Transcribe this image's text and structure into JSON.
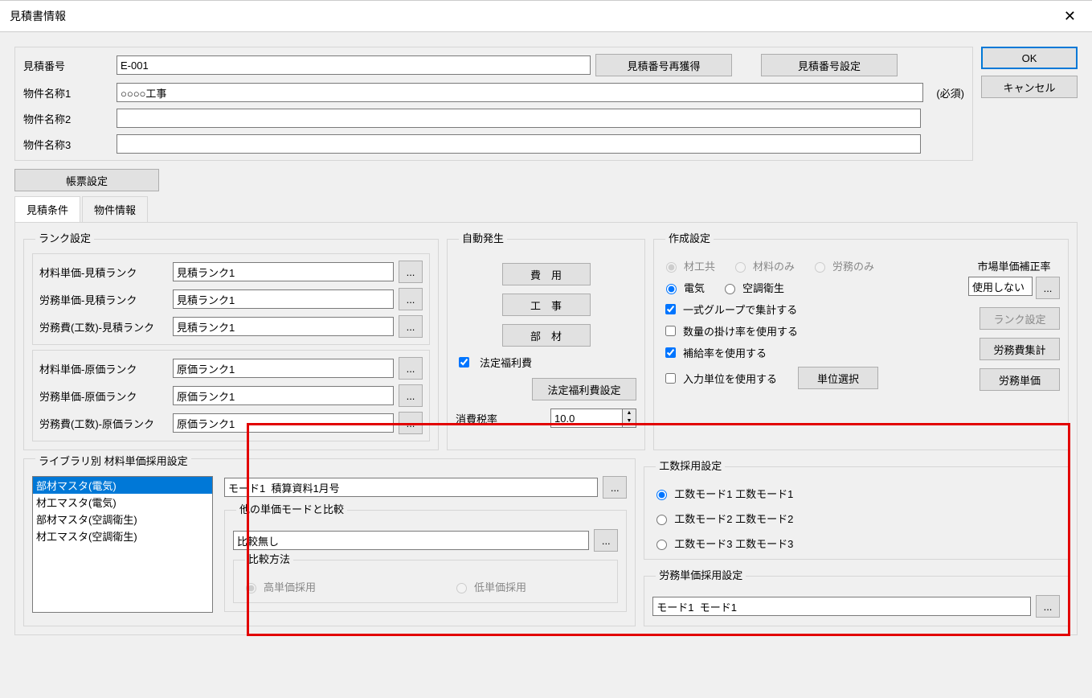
{
  "window": {
    "title": "見積書情報"
  },
  "buttons": {
    "ok": "OK",
    "cancel": "キャンセル",
    "reacquire": "見積番号再獲得",
    "numset": "見積番号設定",
    "form": "帳票設定",
    "cost": "費　用",
    "work": "工　事",
    "parts": "部　材",
    "welfare": "法定福利費設定",
    "rankset": "ランク設定",
    "laboragg": "労務費集計",
    "laborunit": "労務単価",
    "unitsel": "単位選択",
    "ellipsis": "..."
  },
  "labels": {
    "estno": "見積番号",
    "name1": "物件名称1",
    "name2": "物件名称2",
    "name3": "物件名称3",
    "required": "(必須)",
    "tab1": "見積条件",
    "tab2": "物件情報",
    "rank_legend": "ランク設定",
    "auto_legend": "自動発生",
    "create_legend": "作成設定",
    "r1": "材料単価-見積ランク",
    "r2": "労務単価-見積ランク",
    "r3": "労務費(工数)-見積ランク",
    "r4": "材料単価-原価ランク",
    "r5": "労務単価-原価ランク",
    "r6": "労務費(工数)-原価ランク",
    "welfare_chk": "法定福利費",
    "tax": "消費税率",
    "opt_both": "材工共",
    "opt_mat": "材料のみ",
    "opt_lab": "労務のみ",
    "opt_elec": "電気",
    "opt_hvac": "空調衛生",
    "chk_group": "一式グループで集計する",
    "chk_mult": "数量の掛け率を使用する",
    "chk_supp": "補給率を使用する",
    "chk_unit": "入力単位を使用する",
    "market": "市場単価補正率",
    "lib_legend": "ライブラリ別 材料単価採用設定",
    "lib_items": [
      "部材マスタ(電気)",
      "材工マスタ(電気)",
      "部材マスタ(空調衛生)",
      "材工マスタ(空調衛生)"
    ],
    "compare_legend": "他の単価モードと比較",
    "method_legend": "比較方法",
    "high": "高単価採用",
    "low": "低単価採用",
    "manh_legend": "工数採用設定",
    "mh1": "工数モード1 工数モード1",
    "mh2": "工数モード2 工数モード2",
    "mh3": "工数モード3 工数モード3",
    "laborunit_legend": "労務単価採用設定"
  },
  "values": {
    "estno": "E-001",
    "name1": "○○○○工事",
    "name2": "",
    "name3": "",
    "rank_est": "見積ランク1",
    "rank_cost": "原価ランク1",
    "tax": "10.0",
    "market": "使用しない",
    "mode1": "モード1  積算資料1月号",
    "compare": "比較無し",
    "labmode": "モード1  モード1"
  }
}
